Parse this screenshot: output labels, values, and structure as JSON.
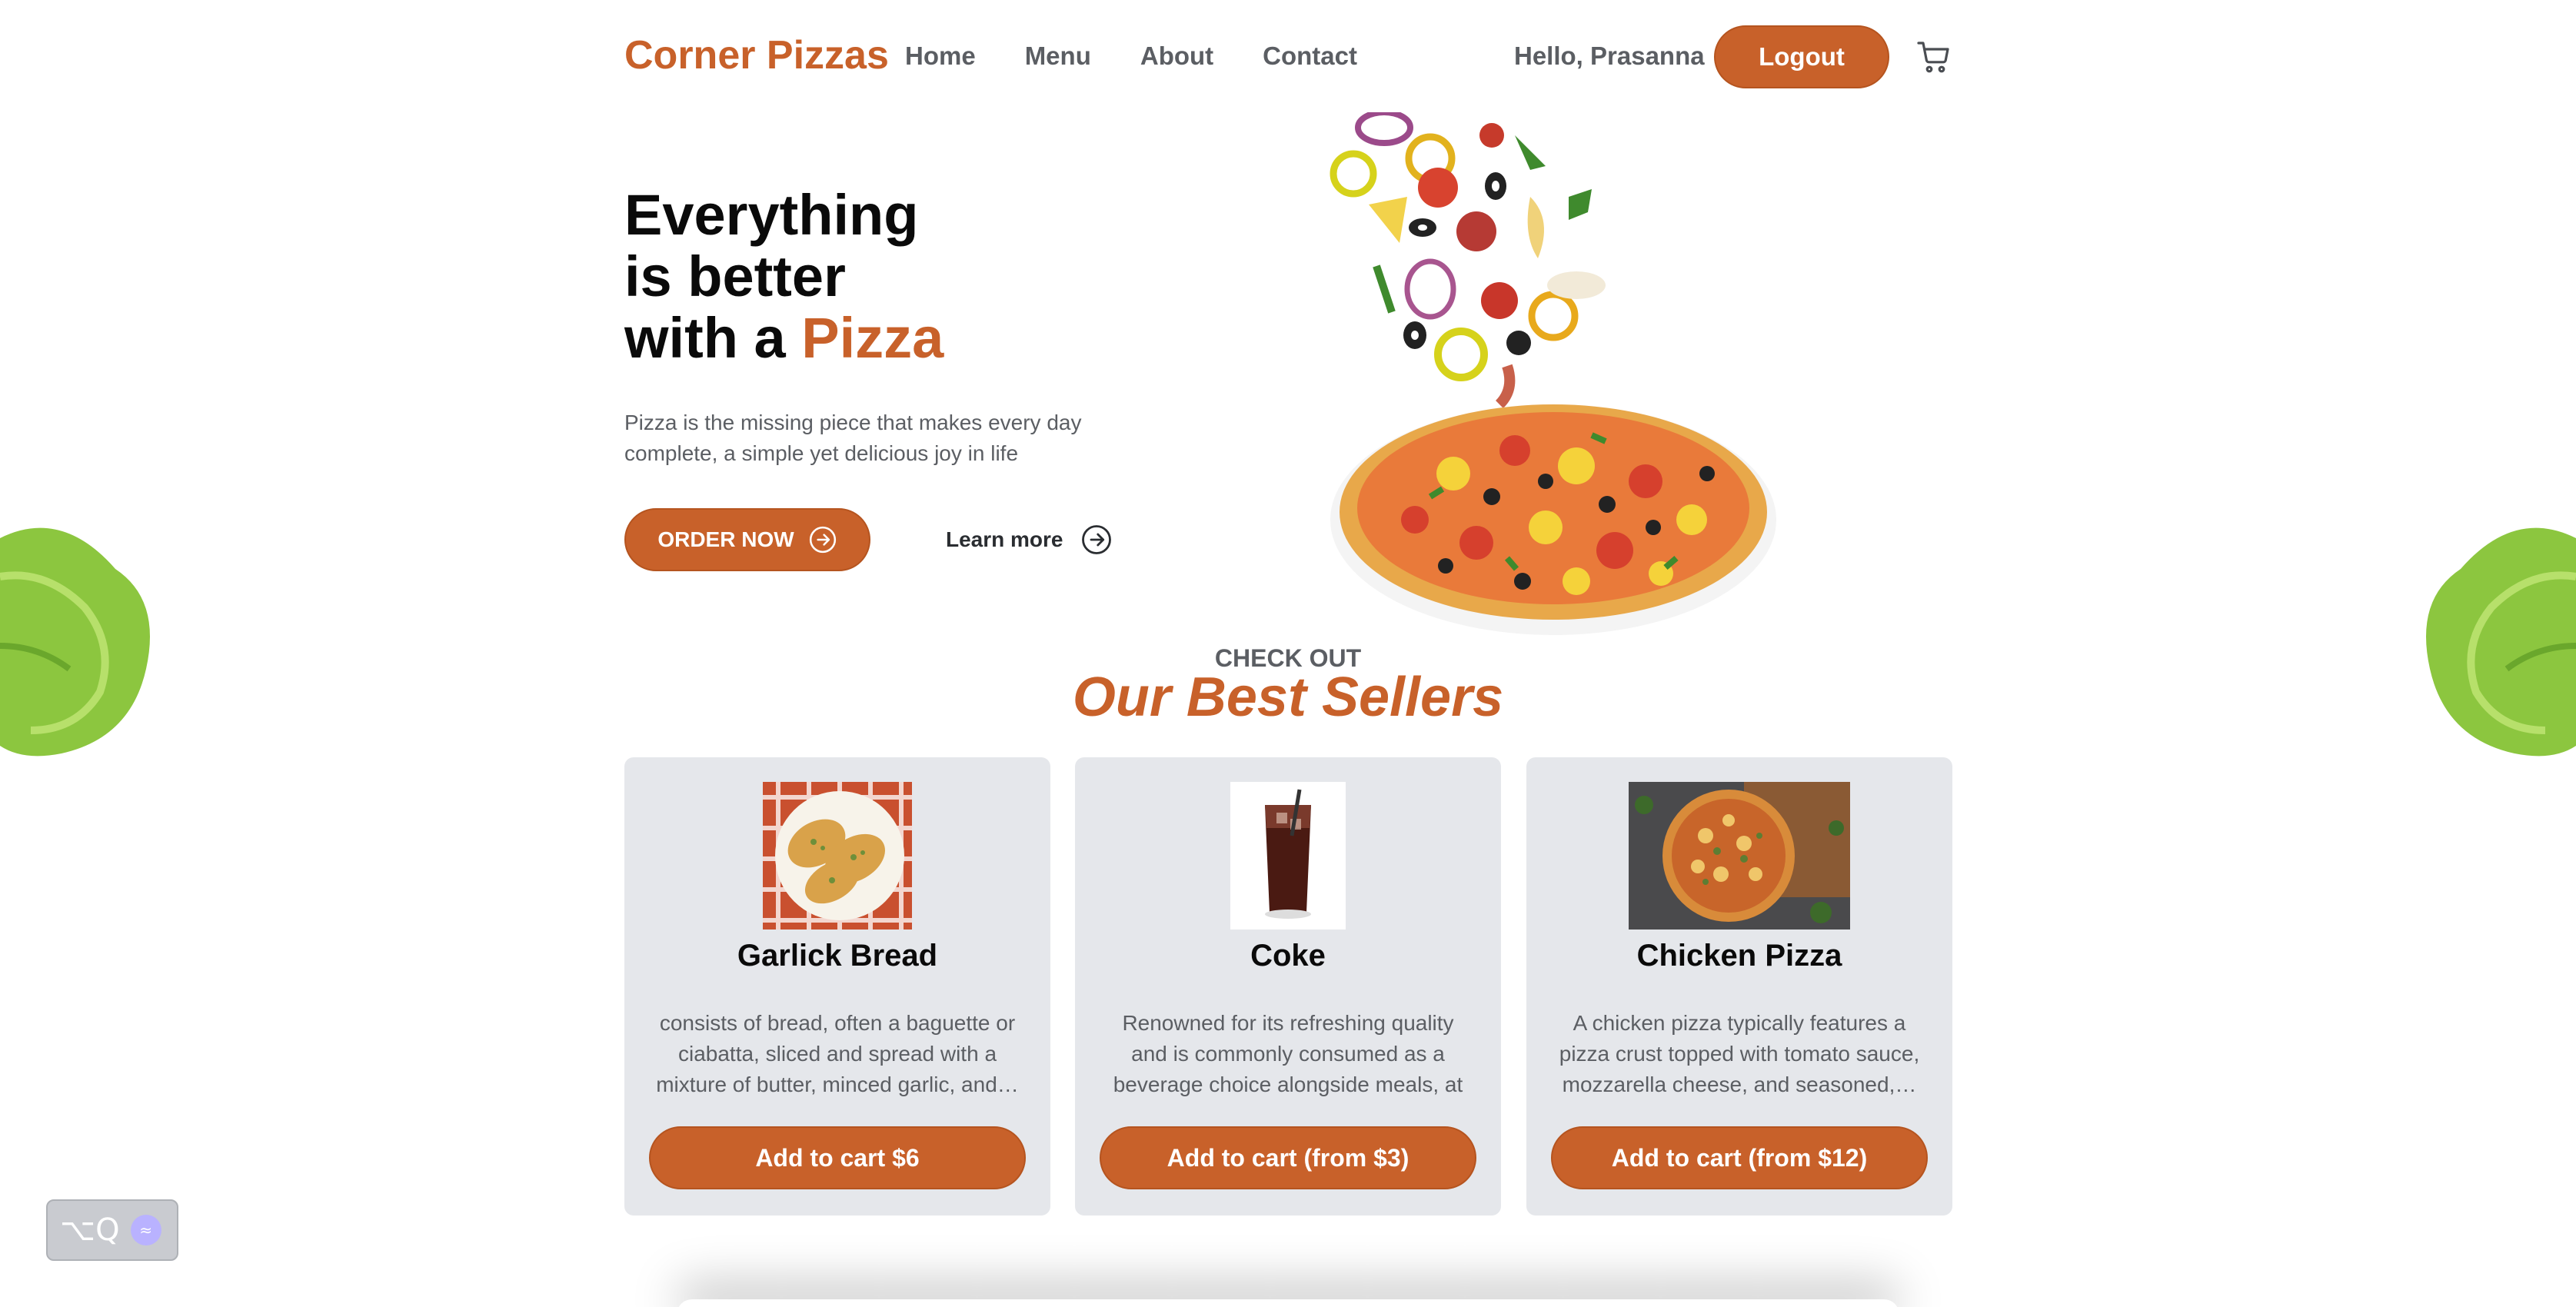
{
  "nav": {
    "logo": "Corner Pizzas",
    "links": [
      "Home",
      "Menu",
      "About",
      "Contact"
    ],
    "greeting": "Hello, Prasanna",
    "logout_label": "Logout"
  },
  "hero": {
    "title_line1": "Everything",
    "title_line2": "is better",
    "title_line3_prefix": "with a ",
    "title_line3_accent": "Pizza",
    "description": "Pizza is the missing piece that makes every day complete, a simple yet delicious joy in life",
    "order_label": "ORDER NOW",
    "learn_label": "Learn more"
  },
  "best_sellers": {
    "eyebrow": "CHECK OUT",
    "title": "Our Best Sellers",
    "items": [
      {
        "name": "Garlick Bread",
        "description": "consists of bread, often a baguette or ciabatta, sliced and spread with a mixture of butter, minced garlic, and…",
        "button": "Add to cart $6"
      },
      {
        "name": "Coke",
        "description": "Renowned for its refreshing quality and is commonly consumed as a beverage choice alongside meals, at social…",
        "button": "Add to cart (from $3)"
      },
      {
        "name": "Chicken Pizza",
        "description": "A chicken pizza typically features a pizza crust topped with tomato sauce, mozzarella cheese, and seasoned,…",
        "button": "Add to cart (from $12)"
      }
    ]
  },
  "hotkey": {
    "label": "⌥Q"
  },
  "colors": {
    "accent": "#c8612a",
    "card_bg": "#e5e7eb",
    "muted_text": "#5b5e63"
  }
}
